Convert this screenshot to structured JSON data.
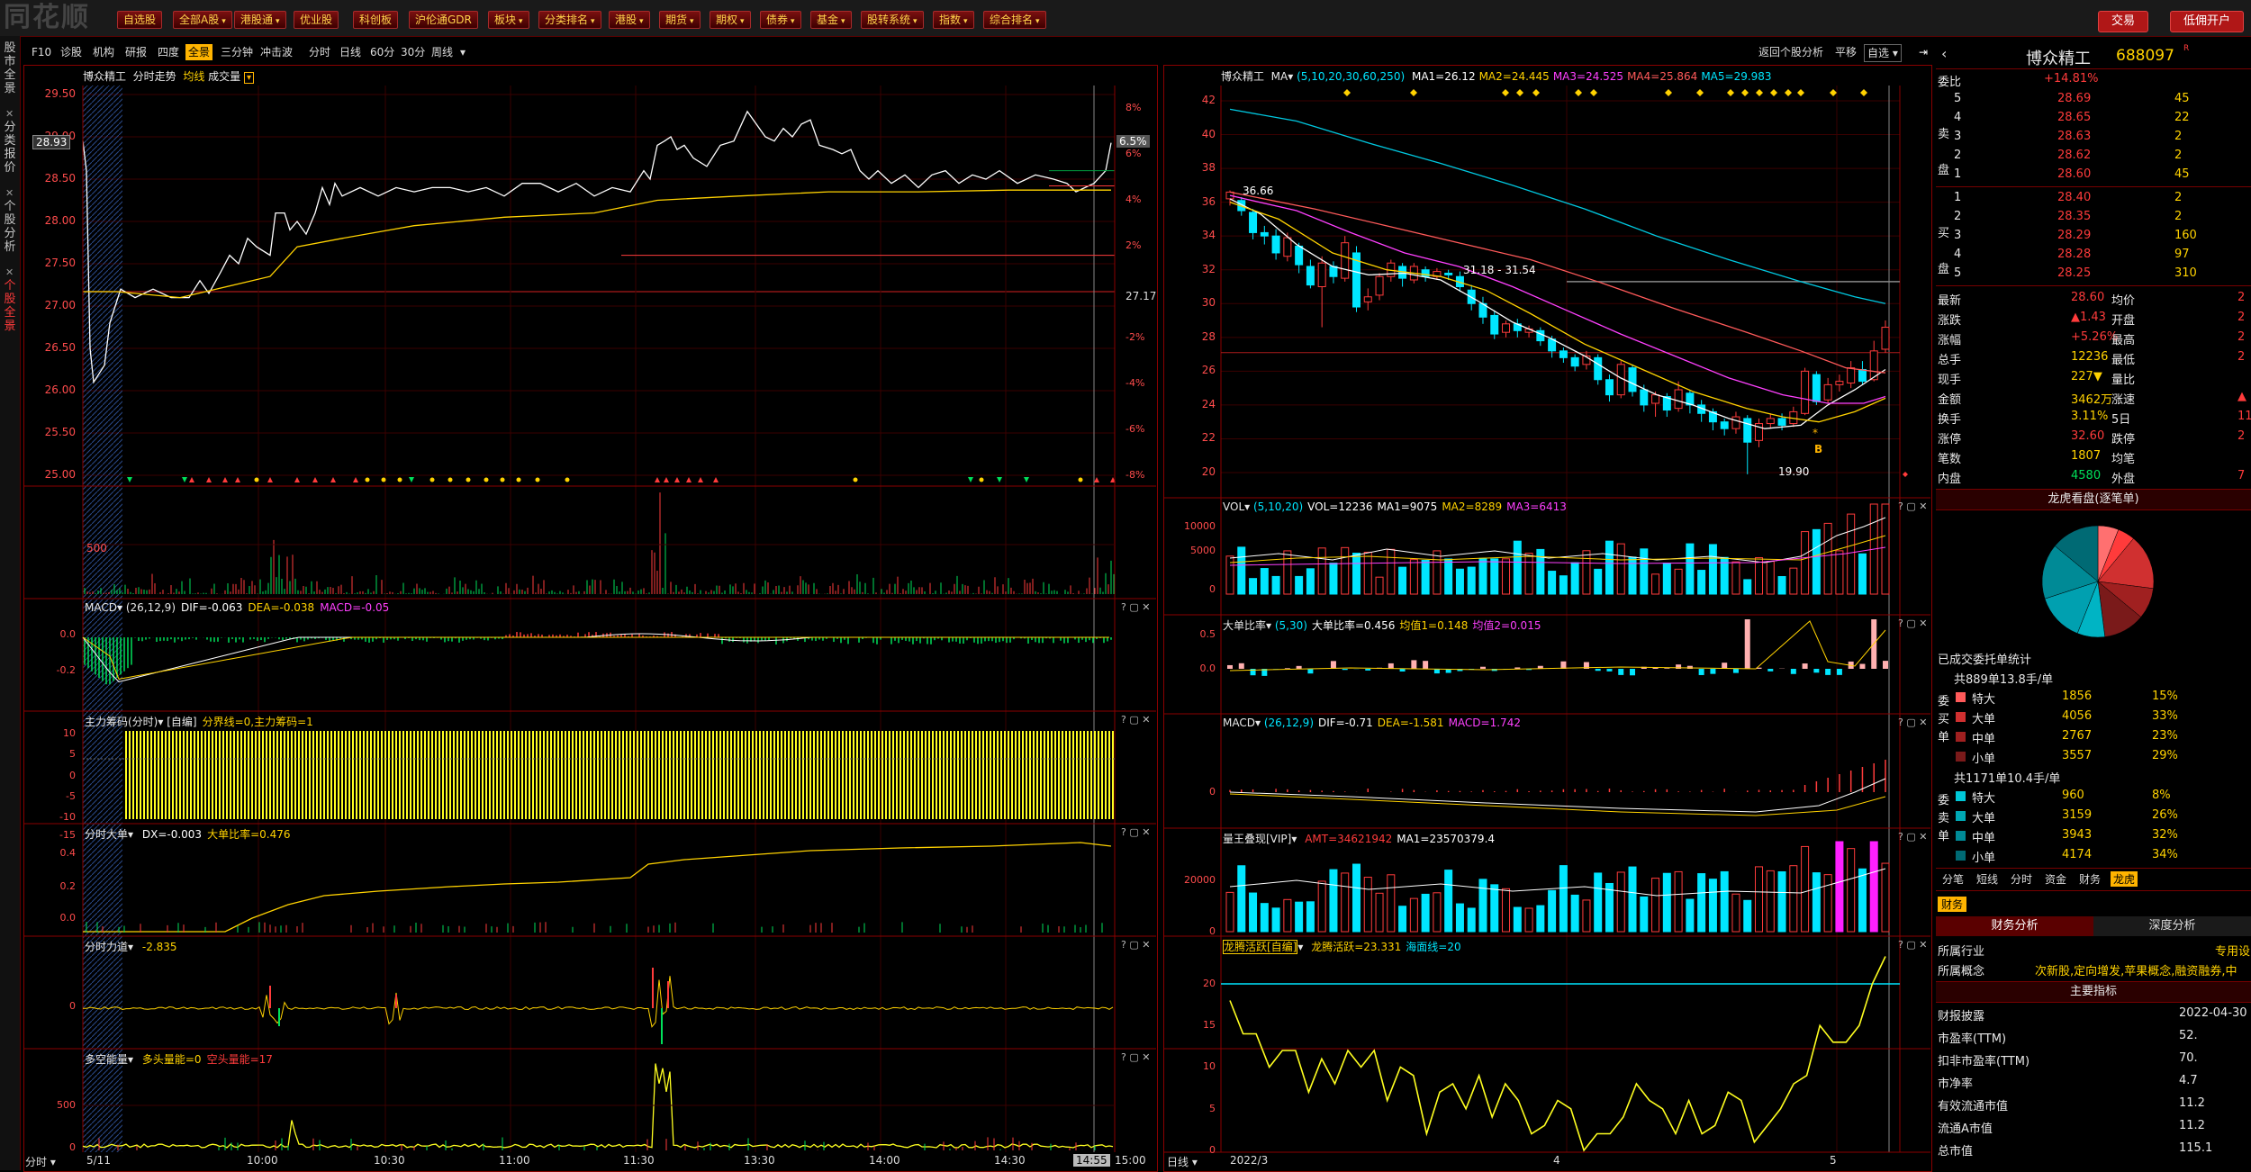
{
  "topbar": {
    "menus": [
      "自选股",
      "全部A股",
      "港股通",
      "优业股",
      "科创板",
      "沪伦通GDR",
      "板块",
      "分类排名",
      "港股",
      "期货",
      "期权",
      "债券",
      "基金",
      "股转系统",
      "指数",
      "综合排名"
    ],
    "dropdown_menus": [
      false,
      true,
      true,
      false,
      false,
      false,
      true,
      true,
      true,
      true,
      true,
      true,
      true,
      true,
      true,
      true
    ],
    "trade_btn": "交易",
    "open_acct_btn": "低佣开户"
  },
  "lefttabs": [
    "股市全景",
    "分类报价",
    "个股分析",
    "个股全景"
  ],
  "toolbar": {
    "left_items": [
      "F10",
      "诊股",
      "机构",
      "研报",
      "四度",
      "全景",
      "三分钟",
      "冲击波",
      "分时",
      "日线",
      "60分",
      "30分",
      "周线"
    ],
    "selected": "全景",
    "right_items": [
      "返回个股分析",
      "平移"
    ],
    "combo_self": "自选"
  },
  "intraday": {
    "title": "博众精工",
    "subtitle_a": "分时走势",
    "subtitle_b": "均线",
    "subtitle_c": "成交量",
    "price_ticks": [
      "29.50",
      "29.00",
      "28.50",
      "28.00",
      "27.50",
      "27.00",
      "26.50",
      "26.00",
      "25.50",
      "25.00"
    ],
    "pct_ticks": [
      "8%",
      "6%",
      "4%",
      "2%",
      "-2%",
      "-4%",
      "-6%",
      "-8%"
    ],
    "prev_close": "27.17",
    "current_tag": "28.93",
    "pct_tag": "6.5%",
    "x_ticks": [
      "5/11",
      "10:00",
      "10:30",
      "11:00",
      "11:30",
      "13:30",
      "14:00",
      "14:30",
      "15:00"
    ],
    "cursor_time": "14:55",
    "bottom_left": "分时",
    "vol_tick": "500"
  },
  "intraday_panels": [
    {
      "name": "MACD",
      "params": "(26,12,9)",
      "vals": [
        {
          "t": "DIF=-0.063",
          "c": "#ffffff"
        },
        {
          "t": "DEA=-0.038",
          "c": "#ffd200"
        },
        {
          "t": "MACD=-0.05",
          "c": "#ff40ff"
        }
      ],
      "ticks": [
        "0.0",
        "-0.2"
      ]
    },
    {
      "name": "主力筹码(分时)",
      "params": "[自编]",
      "vals": [
        {
          "t": "分界线=0,主力筹码=1",
          "c": "#ffd200"
        }
      ],
      "ticks": [
        "10",
        "5",
        "0",
        "-5",
        "-10",
        "-15"
      ]
    },
    {
      "name": "分时大单",
      "params": "",
      "vals": [
        {
          "t": "DX=-0.003",
          "c": "#ffffff"
        },
        {
          "t": "大单比率=0.476",
          "c": "#ffd200"
        }
      ],
      "ticks": [
        "0.4",
        "0.2",
        "0.0"
      ]
    },
    {
      "name": "分时力道",
      "params": "",
      "vals": [
        {
          "t": "-2.835",
          "c": "#ffd200"
        }
      ],
      "ticks": [
        "0"
      ]
    },
    {
      "name": "多空能量",
      "params": "",
      "vals": [
        {
          "t": "多头量能=0",
          "c": "#ffd200"
        },
        {
          "t": "空头量能=17",
          "c": "#ff3b3b"
        }
      ],
      "ticks": [
        "500",
        "0"
      ]
    }
  ],
  "daily": {
    "title": "博众精工",
    "ma_label": "MA",
    "ma_params": "(5,10,20,30,60,250)",
    "ma_vals": [
      {
        "t": "MA1=26.12",
        "c": "#ffffff"
      },
      {
        "t": "MA2=24.445",
        "c": "#ffd200"
      },
      {
        "t": "MA3=24.525",
        "c": "#ff40ff"
      },
      {
        "t": "MA4=25.864",
        "c": "#ff5a5a"
      },
      {
        "t": "MA5=29.983",
        "c": "#00e6ff"
      }
    ],
    "price_ticks": [
      "42",
      "40",
      "38",
      "36",
      "34",
      "32",
      "30",
      "28",
      "26",
      "24",
      "22",
      "20"
    ],
    "high_label": "36.66",
    "range_label": "31.18 - 31.54",
    "low_label": "19.90",
    "b_label": "B",
    "x_ticks": [
      "2022/3",
      "4",
      "5"
    ],
    "bottom_left": "日线"
  },
  "daily_panels": [
    {
      "name": "VOL",
      "params": "(5,10,20)",
      "vals": [
        {
          "t": "VOL=12236",
          "c": "#ffffff"
        },
        {
          "t": "MA1=9075",
          "c": "#ffffff"
        },
        {
          "t": "MA2=8289",
          "c": "#ffd200"
        },
        {
          "t": "MA3=6413",
          "c": "#ff40ff"
        }
      ],
      "ticks": [
        "10000",
        "5000",
        "0"
      ]
    },
    {
      "name": "大单比率",
      "params": "(5,30)",
      "vals": [
        {
          "t": "大单比率=0.456",
          "c": "#ffffff"
        },
        {
          "t": "均值1=0.148",
          "c": "#ffd200"
        },
        {
          "t": "均值2=0.015",
          "c": "#ff40ff"
        }
      ],
      "ticks": [
        "0.5",
        "0.0"
      ]
    },
    {
      "name": "MACD",
      "params": "(26,12,9)",
      "vals": [
        {
          "t": "DIF=-0.71",
          "c": "#ffffff"
        },
        {
          "t": "DEA=-1.581",
          "c": "#ffd200"
        },
        {
          "t": "MACD=1.742",
          "c": "#ff40ff"
        }
      ],
      "ticks": [
        "0"
      ]
    },
    {
      "name": "量王叠现[VIP]",
      "params": "",
      "vals": [
        {
          "t": "AMT=34621942",
          "c": "#ff3b3b"
        },
        {
          "t": "MA1=23570379.4",
          "c": "#ffffff"
        }
      ],
      "ticks": [
        "20000",
        "0"
      ]
    },
    {
      "name": "龙腾活跃[自编]",
      "params": "",
      "vals": [
        {
          "t": "龙腾活跃=23.331",
          "c": "#ffd200"
        },
        {
          "t": "海面线=20",
          "c": "#00e6ff"
        }
      ],
      "ticks": [
        "20",
        "15",
        "10",
        "5",
        "0"
      ]
    }
  ],
  "quote": {
    "name": "博众精工",
    "code": "688097",
    "rz": "R",
    "weibi_label": "委比",
    "weibi_val": "+14.81%",
    "sell": [
      {
        "lvl": "5",
        "price": "28.69",
        "vol": "45"
      },
      {
        "lvl": "4",
        "price": "28.65",
        "vol": "22"
      },
      {
        "lvl": "3",
        "price": "28.63",
        "vol": "2"
      },
      {
        "lvl": "2",
        "price": "28.62",
        "vol": "2"
      },
      {
        "lvl": "1",
        "price": "28.60",
        "vol": "45"
      }
    ],
    "sell_side": "卖盘",
    "buy": [
      {
        "lvl": "1",
        "price": "28.40",
        "vol": "2"
      },
      {
        "lvl": "2",
        "price": "28.35",
        "vol": "2"
      },
      {
        "lvl": "3",
        "price": "28.29",
        "vol": "160"
      },
      {
        "lvl": "4",
        "price": "28.28",
        "vol": "97"
      },
      {
        "lvl": "5",
        "price": "28.25",
        "vol": "310"
      }
    ],
    "buy_side": "买盘",
    "stats": [
      {
        "l": "最新",
        "v": "28.60",
        "vc": "red",
        "l2": "均价",
        "v2": "2"
      },
      {
        "l": "涨跌",
        "v": "▲1.43",
        "vc": "red",
        "l2": "开盘",
        "v2": "2"
      },
      {
        "l": "涨幅",
        "v": "+5.26%",
        "vc": "red",
        "l2": "最高",
        "v2": "2"
      },
      {
        "l": "总手",
        "v": "12236",
        "vc": "yel",
        "l2": "最低",
        "v2": "2"
      },
      {
        "l": "现手",
        "v": "227▼",
        "vc": "yel",
        "l2": "量比",
        "v2": ""
      },
      {
        "l": "金额",
        "v": "3462万",
        "vc": "yel",
        "l2": "涨速",
        "v2": "▲"
      },
      {
        "l": "换手",
        "v": "3.11%",
        "vc": "yel",
        "l2": "5日",
        "v2": "11."
      },
      {
        "l": "涨停",
        "v": "32.60",
        "vc": "red",
        "l2": "跌停",
        "v2": "2"
      },
      {
        "l": "笔数",
        "v": "1807",
        "vc": "yel",
        "l2": "均笔",
        "v2": ""
      },
      {
        "l": "内盘",
        "v": "4580",
        "vc": "green",
        "l2": "外盘",
        "v2": "7"
      }
    ]
  },
  "longhu": {
    "title": "龙虎看盘(逐笔单)",
    "pie": [
      {
        "v": 6,
        "c": "#ff7070"
      },
      {
        "v": 5,
        "c": "#ff3b3b"
      },
      {
        "v": 16,
        "c": "#d03030"
      },
      {
        "v": 9,
        "c": "#a02020"
      },
      {
        "v": 12,
        "c": "#7a1a1a"
      },
      {
        "v": 8,
        "c": "#00b4c4"
      },
      {
        "v": 14,
        "c": "#00a0b0"
      },
      {
        "v": 16,
        "c": "#008a96"
      },
      {
        "v": 14,
        "c": "#006a74"
      }
    ],
    "stat_title": "已成交委托单统计",
    "buy_summary": "共889单13.8手/单",
    "buy_side": "委买单",
    "buy_rows": [
      {
        "t": "特大",
        "n": "1856",
        "p": "15%",
        "c": "#ff5a5a"
      },
      {
        "t": "大单",
        "n": "4056",
        "p": "33%",
        "c": "#d03030"
      },
      {
        "t": "中单",
        "n": "2767",
        "p": "23%",
        "c": "#a02020"
      },
      {
        "t": "小单",
        "n": "3557",
        "p": "29%",
        "c": "#7a1a1a"
      }
    ],
    "sell_summary": "共1171单10.4手/单",
    "sell_side": "委卖单",
    "sell_rows": [
      {
        "t": "特大",
        "n": "960",
        "p": "8%",
        "c": "#00c8d8"
      },
      {
        "t": "大单",
        "n": "3159",
        "p": "26%",
        "c": "#00a8b4"
      },
      {
        "t": "中单",
        "n": "3943",
        "p": "32%",
        "c": "#008a96"
      },
      {
        "t": "小单",
        "n": "4174",
        "p": "34%",
        "c": "#006a74"
      }
    ],
    "tabs": [
      "分笔",
      "短线",
      "分时",
      "资金",
      "财务",
      "龙虎"
    ],
    "active_tab": "龙虎"
  },
  "finance": {
    "tab": "财务",
    "subtabs": [
      "财务分析",
      "深度分析"
    ],
    "industry_label": "所属行业",
    "industry_val": "专用设",
    "concept_label": "所属概念",
    "concept_val": "次新股,定向增发,苹果概念,融资融券,中",
    "main_title": "主要指标",
    "rows": [
      {
        "l": "财报披露",
        "v": "2022-04-30"
      },
      {
        "l": "市盈率(TTM)",
        "v": "52."
      },
      {
        "l": "扣非市盈率(TTM)",
        "v": "70."
      },
      {
        "l": "市净率",
        "v": "4.7"
      },
      {
        "l": "有效流通市值",
        "v": "11.2"
      },
      {
        "l": "流通A市值",
        "v": "11.2"
      },
      {
        "l": "总市值",
        "v": "115.1"
      }
    ]
  },
  "colors": {
    "up": "#ff3b3b",
    "down": "#00e6ff",
    "frame": "#8a0000",
    "accent": "#ffb400"
  }
}
